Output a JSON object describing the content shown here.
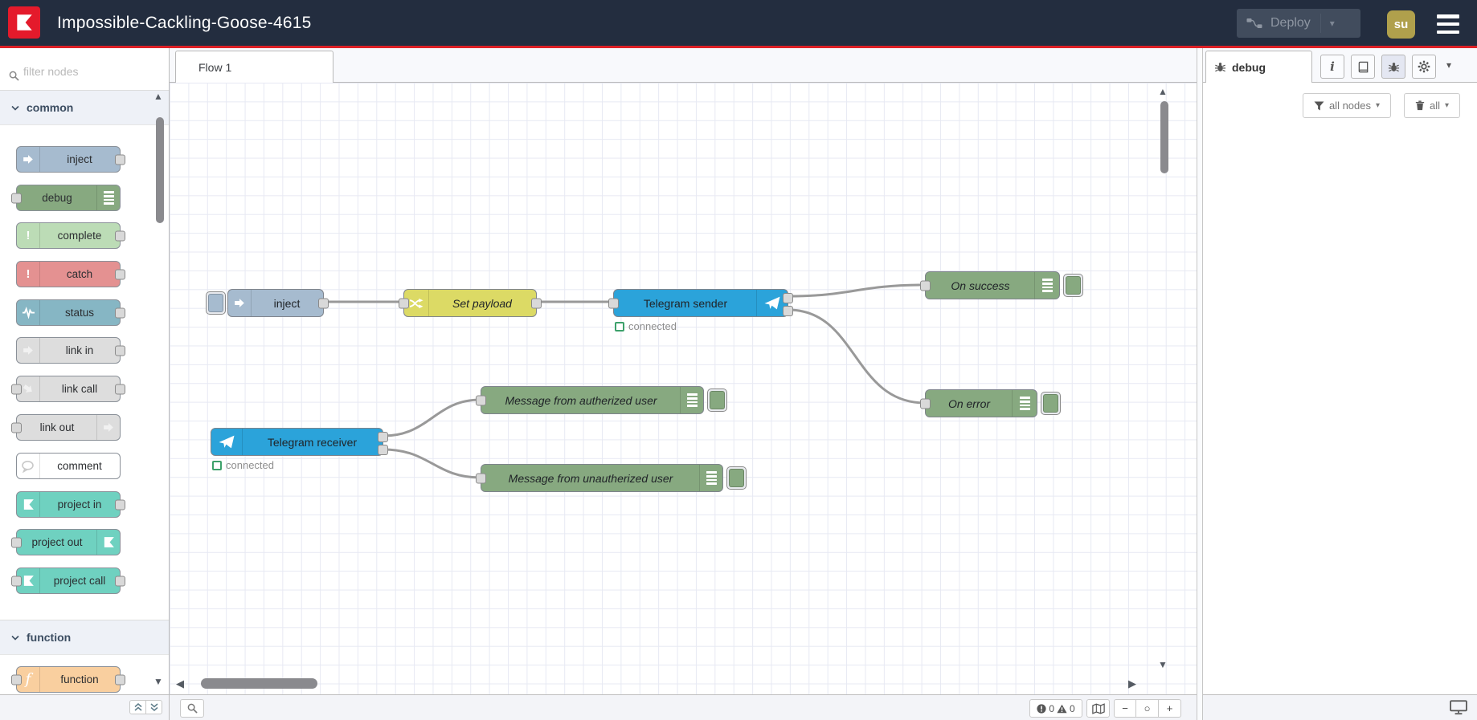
{
  "header": {
    "title": "Impossible-Cackling-Goose-4615",
    "deploy_label": "Deploy",
    "avatar_text": "su"
  },
  "icons": {
    "caret_down": "▾",
    "tri_up": "▲",
    "tri_down": "▼",
    "tri_left": "◀",
    "tri_right": "▶",
    "play": "▶",
    "plus": "+",
    "info": "i",
    "exclamation": "!",
    "function_f": "f"
  },
  "colors": {
    "accent_red": "#dd2026",
    "header_bg": "#232d3f",
    "avatar_bg": "#b0a04c",
    "node_inject": "#a6bbcf",
    "node_debug": "#87a980",
    "node_complete": "#bcdcb6",
    "node_catch": "#e49191",
    "node_status": "#86b6c4",
    "node_link": "#dddddd",
    "node_comment": "#ffffff",
    "node_project": "#6fd1c0",
    "node_function": "#f9cf9f",
    "node_change": "#dcda65",
    "node_telegram": "#2ba3da",
    "status_connected_green": "#3da16b",
    "wire": "#999999"
  },
  "palette": {
    "filter_placeholder": "filter nodes",
    "category_common": "common",
    "category_function": "function",
    "items": [
      {
        "label": "inject"
      },
      {
        "label": "debug"
      },
      {
        "label": "complete"
      },
      {
        "label": "catch"
      },
      {
        "label": "status"
      },
      {
        "label": "link in"
      },
      {
        "label": "link call"
      },
      {
        "label": "link out"
      },
      {
        "label": "comment"
      },
      {
        "label": "project in"
      },
      {
        "label": "project out"
      },
      {
        "label": "project call"
      },
      {
        "label": "function"
      }
    ]
  },
  "flow": {
    "tab_label": "Flow 1",
    "status_connected": "connected",
    "nodes": {
      "inject": "inject",
      "set_payload": "Set payload",
      "telegram_sender": "Telegram sender",
      "on_success": "On success",
      "on_error": "On error",
      "telegram_receiver": "Telegram receiver",
      "msg_authorized": "Message from autherized user",
      "msg_unauthorized": "Message from unautherized user"
    }
  },
  "canvas_footer": {
    "error_count": "0",
    "warning_count": "0",
    "zoom_out": "−",
    "zoom_reset": "○",
    "zoom_in": "+"
  },
  "sidebar": {
    "tab_label": "debug",
    "filter_all_nodes": "all nodes",
    "clear_all": "all"
  }
}
